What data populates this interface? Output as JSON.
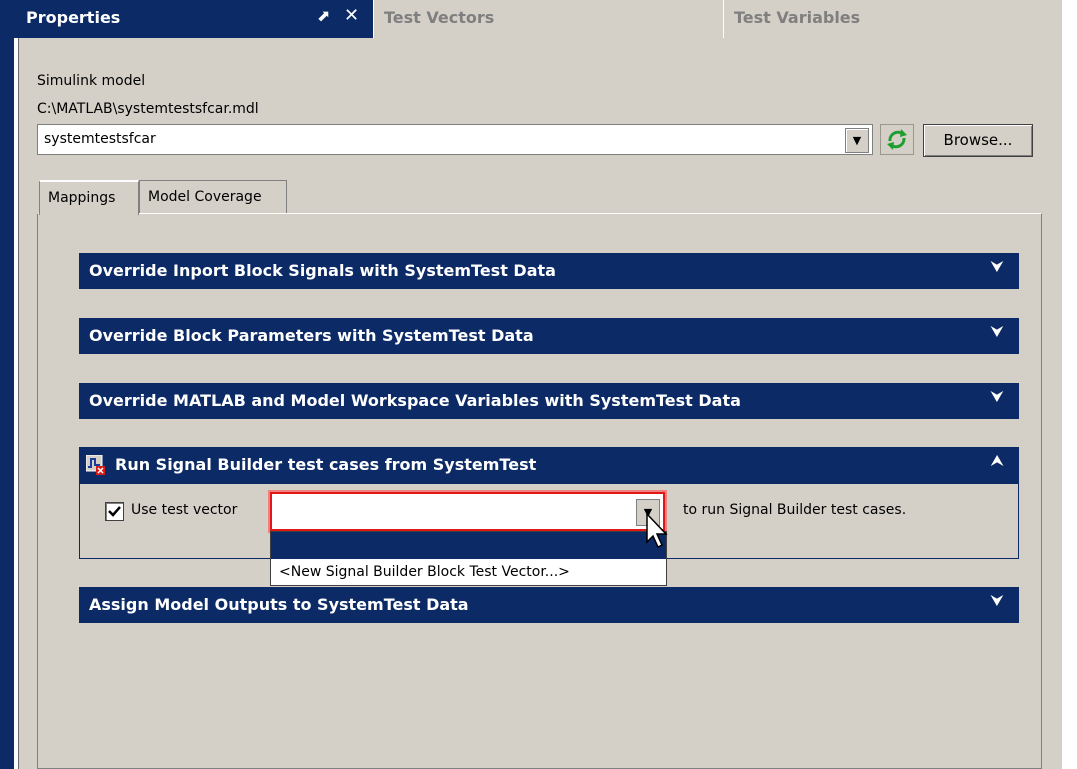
{
  "tabs": {
    "properties": "Properties",
    "test_vectors": "Test Vectors",
    "test_variables": "Test Variables"
  },
  "model": {
    "label": "Simulink model",
    "path": "C:\\MATLAB\\systemtestsfcar.mdl",
    "selected": "systemtestsfcar",
    "browse_label": "Browse..."
  },
  "subtabs": {
    "mappings": "Mappings",
    "coverage": "Model Coverage"
  },
  "sections": {
    "inport": "Override Inport Block Signals with SystemTest Data",
    "params": "Override Block Parameters with SystemTest Data",
    "workspace": "Override MATLAB and Model Workspace Variables with SystemTest Data",
    "signal_builder": "Run Signal Builder test cases from SystemTest",
    "outputs": "Assign Model Outputs to SystemTest Data"
  },
  "signal_builder": {
    "checkbox_label": "Use test vector",
    "checked": true,
    "selected_value": "",
    "suffix": "to run Signal Builder test cases.",
    "options": [
      "",
      "<New Signal Builder Block Test Vector...>"
    ]
  },
  "colors": {
    "title_blue": "#0b2a66",
    "panel_gray": "#d4d0c8",
    "highlight_red": "#e01818"
  },
  "icons": {
    "pin": "pin-icon",
    "close": "close-icon",
    "refresh": "refresh-icon",
    "collapse": "chevron-up-double-icon",
    "expand": "chevron-down-double-icon"
  }
}
